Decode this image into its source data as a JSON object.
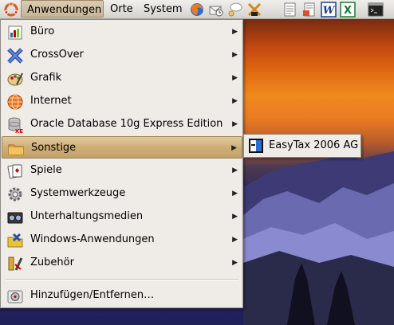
{
  "panel": {
    "menus": [
      "Anwendungen",
      "Orte",
      "System"
    ],
    "launchers": [
      "firefox-icon",
      "mail-icon",
      "help-icon",
      "tools-icon",
      "notes-icon",
      "document-icon",
      "word-icon",
      "excel-icon",
      "terminal-icon"
    ]
  },
  "menu": {
    "items": [
      {
        "label": "Büro",
        "icon": "office-icon",
        "has_submenu": true
      },
      {
        "label": "CrossOver",
        "icon": "crossover-icon",
        "has_submenu": true
      },
      {
        "label": "Grafik",
        "icon": "graphics-icon",
        "has_submenu": true
      },
      {
        "label": "Internet",
        "icon": "internet-icon",
        "has_submenu": true
      },
      {
        "label": "Oracle Database 10g Express Edition",
        "icon": "oracle-icon",
        "has_submenu": true
      },
      {
        "label": "Sonstige",
        "icon": "folder-icon",
        "has_submenu": true,
        "selected": true
      },
      {
        "label": "Spiele",
        "icon": "games-icon",
        "has_submenu": true
      },
      {
        "label": "Systemwerkzeuge",
        "icon": "system-tools-icon",
        "has_submenu": true
      },
      {
        "label": "Unterhaltungsmedien",
        "icon": "multimedia-icon",
        "has_submenu": true
      },
      {
        "label": "Windows-Anwendungen",
        "icon": "windows-apps-icon",
        "has_submenu": true
      },
      {
        "label": "Zubehör",
        "icon": "accessories-icon",
        "has_submenu": true
      }
    ],
    "footer_item": {
      "label": "Hinzufügen/Entfernen…",
      "icon": "add-remove-icon"
    }
  },
  "submenu": {
    "items": [
      {
        "label": "EasyTax 2006 AG",
        "icon": "easytax-icon"
      }
    ]
  },
  "colors": {
    "selection": "#cfae76",
    "menu_bg": "#efebe7"
  }
}
